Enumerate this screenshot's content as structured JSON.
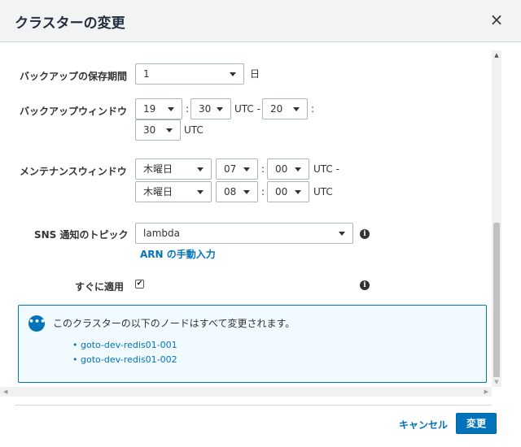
{
  "modal": {
    "title": "クラスターの変更",
    "close_glyph": "×"
  },
  "backup_retention": {
    "label": "バックアップの保存期間",
    "value": "1",
    "unit": "日"
  },
  "backup_window": {
    "label": "バックアップウィンドウ",
    "start_hour": "19",
    "start_minute": "30",
    "utc_dash": "UTC -",
    "duration_hour": "20",
    "duration_minute": "30",
    "utc": "UTC",
    "colon": ":"
  },
  "maintenance_window": {
    "label": "メンテナンスウィンドウ",
    "start_day": "木曜日",
    "start_hour": "07",
    "start_minute": "00",
    "utc_dash": "UTC -",
    "end_day": "木曜日",
    "end_hour": "08",
    "end_minute": "00",
    "utc": "UTC",
    "colon": ":"
  },
  "sns": {
    "label": "SNS 通知のトピック",
    "value": "lambda",
    "arn_link": "ARN の手動入力"
  },
  "apply_immediately": {
    "label": "すぐに適用",
    "checked": true,
    "check_glyph": "✔"
  },
  "info_glyph": "i",
  "alert": {
    "icon_glyph": "•••",
    "title": "このクラスターの以下のノードはすべて変更されます。",
    "nodes": [
      "goto-dev-redis01-001",
      "goto-dev-redis01-002"
    ],
    "color": "#0073bb"
  },
  "footer": {
    "cancel_label": "キャンセル",
    "submit_label": "変更"
  },
  "colors": {
    "primary": "#0073bb",
    "header_bg": "#f2f3f3"
  }
}
